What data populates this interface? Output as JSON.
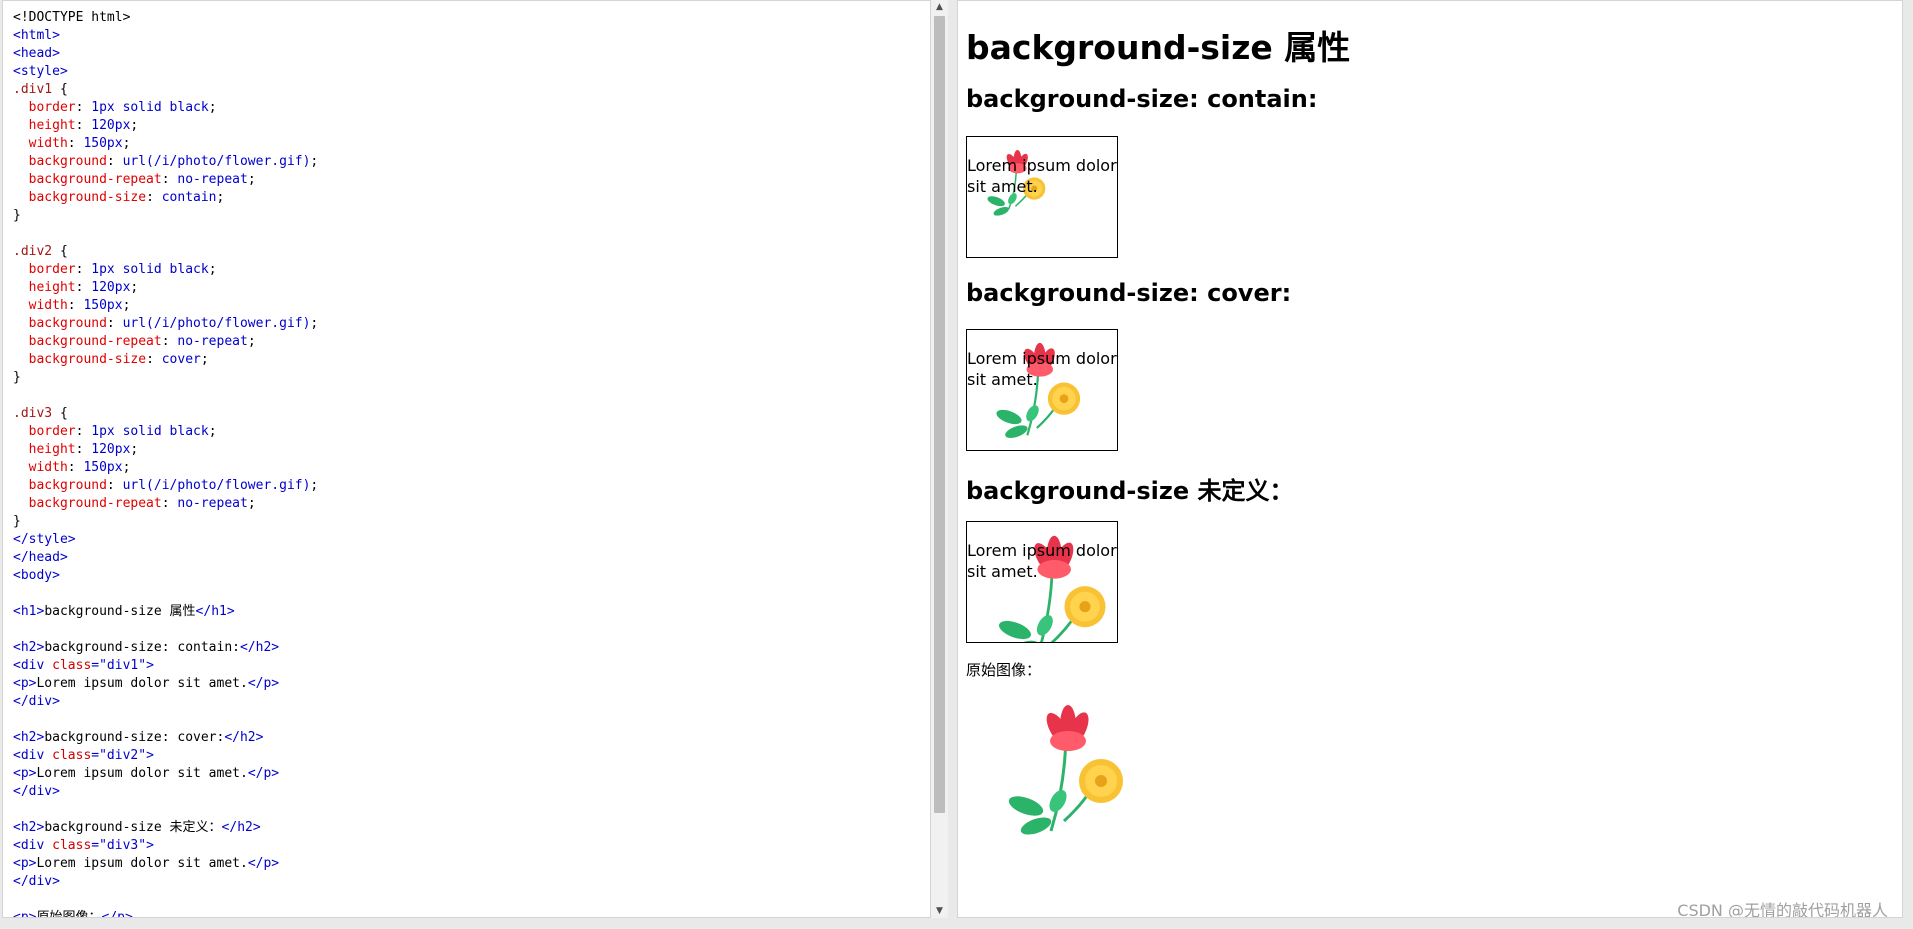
{
  "editor": {
    "lines": [
      [
        {
          "t": "<!DOCTYPE html>",
          "c": "text"
        }
      ],
      [
        {
          "t": "<html>",
          "c": "tag"
        }
      ],
      [
        {
          "t": "<head>",
          "c": "tag"
        }
      ],
      [
        {
          "t": "<style>",
          "c": "tag"
        }
      ],
      [
        {
          "t": ".div1",
          "c": "sel"
        },
        {
          "t": " {",
          "c": "punct"
        }
      ],
      [
        {
          "t": "  border",
          "c": "prop"
        },
        {
          "t": ": ",
          "c": "punct"
        },
        {
          "t": "1px solid black",
          "c": "val"
        },
        {
          "t": ";",
          "c": "punct"
        }
      ],
      [
        {
          "t": "  height",
          "c": "prop"
        },
        {
          "t": ": ",
          "c": "punct"
        },
        {
          "t": "120px",
          "c": "val"
        },
        {
          "t": ";",
          "c": "punct"
        }
      ],
      [
        {
          "t": "  width",
          "c": "prop"
        },
        {
          "t": ": ",
          "c": "punct"
        },
        {
          "t": "150px",
          "c": "val"
        },
        {
          "t": ";",
          "c": "punct"
        }
      ],
      [
        {
          "t": "  background",
          "c": "prop"
        },
        {
          "t": ": ",
          "c": "punct"
        },
        {
          "t": "url(/i/photo/flower.gif)",
          "c": "val"
        },
        {
          "t": ";",
          "c": "punct"
        }
      ],
      [
        {
          "t": "  background-repeat",
          "c": "prop"
        },
        {
          "t": ": ",
          "c": "punct"
        },
        {
          "t": "no-repeat",
          "c": "val"
        },
        {
          "t": ";",
          "c": "punct"
        }
      ],
      [
        {
          "t": "  background-size",
          "c": "prop"
        },
        {
          "t": ": ",
          "c": "punct"
        },
        {
          "t": "contain",
          "c": "val"
        },
        {
          "t": ";",
          "c": "punct"
        }
      ],
      [
        {
          "t": "}",
          "c": "punct"
        }
      ],
      [],
      [
        {
          "t": ".div2",
          "c": "sel"
        },
        {
          "t": " {",
          "c": "punct"
        }
      ],
      [
        {
          "t": "  border",
          "c": "prop"
        },
        {
          "t": ": ",
          "c": "punct"
        },
        {
          "t": "1px solid black",
          "c": "val"
        },
        {
          "t": ";",
          "c": "punct"
        }
      ],
      [
        {
          "t": "  height",
          "c": "prop"
        },
        {
          "t": ": ",
          "c": "punct"
        },
        {
          "t": "120px",
          "c": "val"
        },
        {
          "t": ";",
          "c": "punct"
        }
      ],
      [
        {
          "t": "  width",
          "c": "prop"
        },
        {
          "t": ": ",
          "c": "punct"
        },
        {
          "t": "150px",
          "c": "val"
        },
        {
          "t": ";",
          "c": "punct"
        }
      ],
      [
        {
          "t": "  background",
          "c": "prop"
        },
        {
          "t": ": ",
          "c": "punct"
        },
        {
          "t": "url(/i/photo/flower.gif)",
          "c": "val"
        },
        {
          "t": ";",
          "c": "punct"
        }
      ],
      [
        {
          "t": "  background-repeat",
          "c": "prop"
        },
        {
          "t": ": ",
          "c": "punct"
        },
        {
          "t": "no-repeat",
          "c": "val"
        },
        {
          "t": ";",
          "c": "punct"
        }
      ],
      [
        {
          "t": "  background-size",
          "c": "prop"
        },
        {
          "t": ": ",
          "c": "punct"
        },
        {
          "t": "cover",
          "c": "val"
        },
        {
          "t": ";",
          "c": "punct"
        }
      ],
      [
        {
          "t": "}",
          "c": "punct"
        }
      ],
      [],
      [
        {
          "t": ".div3",
          "c": "sel"
        },
        {
          "t": " {",
          "c": "punct"
        }
      ],
      [
        {
          "t": "  border",
          "c": "prop"
        },
        {
          "t": ": ",
          "c": "punct"
        },
        {
          "t": "1px solid black",
          "c": "val"
        },
        {
          "t": ";",
          "c": "punct"
        }
      ],
      [
        {
          "t": "  height",
          "c": "prop"
        },
        {
          "t": ": ",
          "c": "punct"
        },
        {
          "t": "120px",
          "c": "val"
        },
        {
          "t": ";",
          "c": "punct"
        }
      ],
      [
        {
          "t": "  width",
          "c": "prop"
        },
        {
          "t": ": ",
          "c": "punct"
        },
        {
          "t": "150px",
          "c": "val"
        },
        {
          "t": ";",
          "c": "punct"
        }
      ],
      [
        {
          "t": "  background",
          "c": "prop"
        },
        {
          "t": ": ",
          "c": "punct"
        },
        {
          "t": "url(/i/photo/flower.gif)",
          "c": "val"
        },
        {
          "t": ";",
          "c": "punct"
        }
      ],
      [
        {
          "t": "  background-repeat",
          "c": "prop"
        },
        {
          "t": ": ",
          "c": "punct"
        },
        {
          "t": "no-repeat",
          "c": "val"
        },
        {
          "t": ";",
          "c": "punct"
        }
      ],
      [
        {
          "t": "}",
          "c": "punct"
        }
      ],
      [
        {
          "t": "</style>",
          "c": "tag"
        }
      ],
      [
        {
          "t": "</head>",
          "c": "tag"
        }
      ],
      [
        {
          "t": "<body>",
          "c": "tag"
        }
      ],
      [],
      [
        {
          "t": "<h1>",
          "c": "tag"
        },
        {
          "t": "background-size 属性",
          "c": "text"
        },
        {
          "t": "</h1>",
          "c": "tag"
        }
      ],
      [],
      [
        {
          "t": "<h2>",
          "c": "tag"
        },
        {
          "t": "background-size: contain:",
          "c": "text"
        },
        {
          "t": "</h2>",
          "c": "tag"
        }
      ],
      [
        {
          "t": "<div ",
          "c": "tag"
        },
        {
          "t": "class",
          "c": "attr"
        },
        {
          "t": "=",
          "c": "tag"
        },
        {
          "t": "\"div1\"",
          "c": "str"
        },
        {
          "t": ">",
          "c": "tag"
        }
      ],
      [
        {
          "t": "<p>",
          "c": "tag"
        },
        {
          "t": "Lorem ipsum dolor sit amet.",
          "c": "text"
        },
        {
          "t": "</p>",
          "c": "tag"
        }
      ],
      [
        {
          "t": "</div>",
          "c": "tag"
        }
      ],
      [],
      [
        {
          "t": "<h2>",
          "c": "tag"
        },
        {
          "t": "background-size: cover:",
          "c": "text"
        },
        {
          "t": "</h2>",
          "c": "tag"
        }
      ],
      [
        {
          "t": "<div ",
          "c": "tag"
        },
        {
          "t": "class",
          "c": "attr"
        },
        {
          "t": "=",
          "c": "tag"
        },
        {
          "t": "\"div2\"",
          "c": "str"
        },
        {
          "t": ">",
          "c": "tag"
        }
      ],
      [
        {
          "t": "<p>",
          "c": "tag"
        },
        {
          "t": "Lorem ipsum dolor sit amet.",
          "c": "text"
        },
        {
          "t": "</p>",
          "c": "tag"
        }
      ],
      [
        {
          "t": "</div>",
          "c": "tag"
        }
      ],
      [],
      [
        {
          "t": "<h2>",
          "c": "tag"
        },
        {
          "t": "background-size 未定义：",
          "c": "text"
        },
        {
          "t": "</h2>",
          "c": "tag"
        }
      ],
      [
        {
          "t": "<div ",
          "c": "tag"
        },
        {
          "t": "class",
          "c": "attr"
        },
        {
          "t": "=",
          "c": "tag"
        },
        {
          "t": "\"div3\"",
          "c": "str"
        },
        {
          "t": ">",
          "c": "tag"
        }
      ],
      [
        {
          "t": "<p>",
          "c": "tag"
        },
        {
          "t": "Lorem ipsum dolor sit amet.",
          "c": "text"
        },
        {
          "t": "</p>",
          "c": "tag"
        }
      ],
      [
        {
          "t": "</div>",
          "c": "tag"
        }
      ],
      [],
      [
        {
          "t": "<p>",
          "c": "tag"
        },
        {
          "t": "原始图像：",
          "c": "text"
        },
        {
          "t": "</p>",
          "c": "tag"
        }
      ]
    ]
  },
  "result": {
    "h1": "background-size 属性",
    "h2_contain": "background-size: contain:",
    "h2_cover": "background-size: cover:",
    "h2_undefined": "background-size 未定义：",
    "lorem": "Lorem ipsum dolor sit amet.",
    "original_label": "原始图像："
  },
  "watermark": "CSDN @无情的敲代码机器人",
  "icons": {
    "scroll_up": "triangle-up",
    "scroll_down": "triangle-down"
  },
  "colors": {
    "tag": "#0000cc",
    "selector": "#a31515",
    "property": "#e00000",
    "flower_red": "#e8344a",
    "flower_yellow": "#f9c234",
    "leaf_green": "#2cb36a"
  }
}
